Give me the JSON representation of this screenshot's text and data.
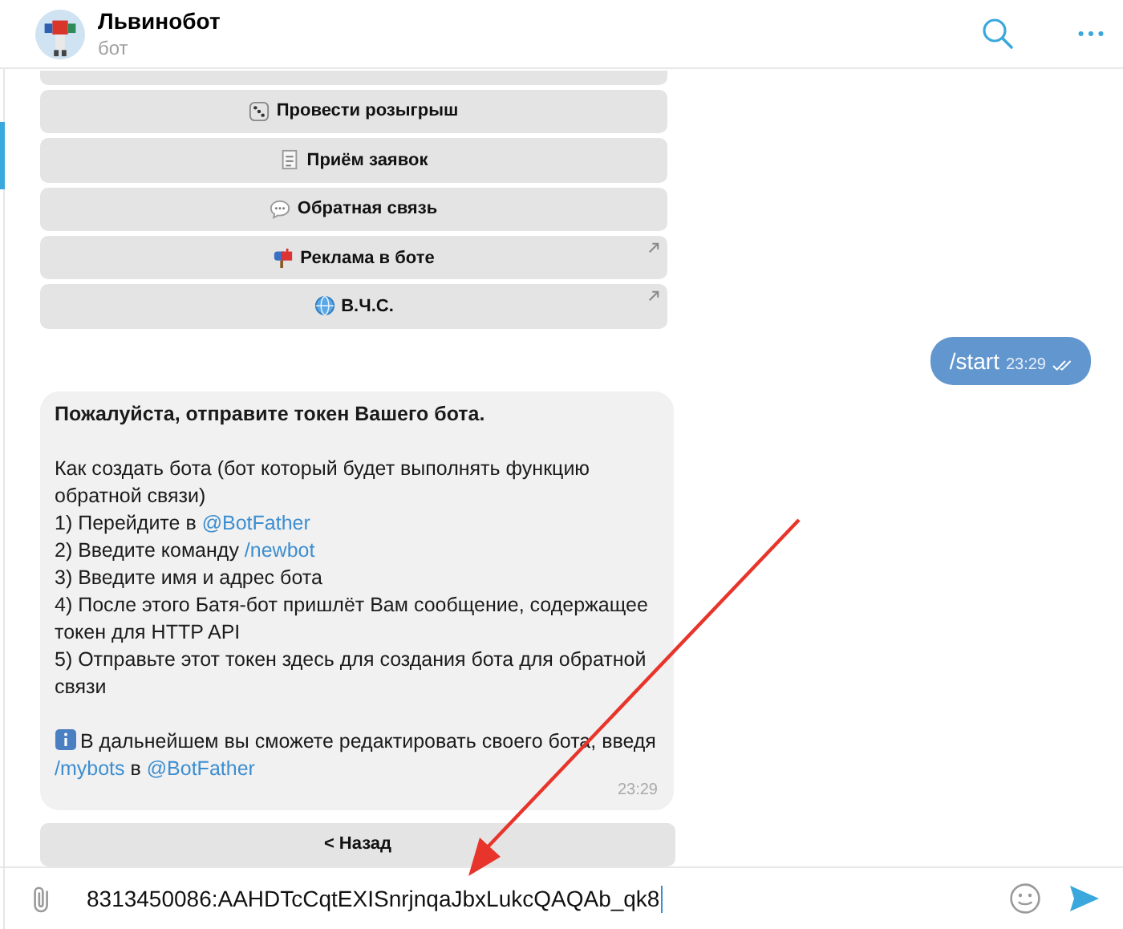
{
  "header": {
    "title": "Львинобот",
    "subtitle": "бот"
  },
  "keyboard_buttons": [
    {
      "label": "Провести розыгрыш",
      "opens_link": false
    },
    {
      "label": "Приём заявок",
      "opens_link": false
    },
    {
      "label": "Обратная связь",
      "opens_link": false
    },
    {
      "label": "Реклама в боте",
      "opens_link": true
    },
    {
      "label": "В.Ч.С.",
      "opens_link": true
    }
  ],
  "outgoing": {
    "text": "/start",
    "time": "23:29",
    "read": true
  },
  "incoming": {
    "title": "Пожалуйста, отправите токен Вашего бота.",
    "time": "23:29",
    "blocks": [
      [
        [
          {
            "text": "Как создать бота (бот который будет выполнять функцию обратной связи)",
            "link": false
          }
        ],
        [
          {
            "text": "1) Перейдите в ",
            "link": false
          },
          {
            "text": "@BotFather",
            "link": true
          }
        ],
        [
          {
            "text": "2) Введите команду ",
            "link": false
          },
          {
            "text": "/newbot",
            "link": true
          }
        ],
        [
          {
            "text": "3) Введите имя и адрес бота",
            "link": false
          }
        ],
        [
          {
            "text": "4) После этого Батя-бот пришлёт Вам сообщение, содержащее токен для HTTP API",
            "link": false
          }
        ],
        [
          {
            "text": "5) Отправьте этот токен здесь для создания бота для обратной связи",
            "link": false
          }
        ]
      ],
      [
        [
          {
            "text": "В дальнейшем вы сможете редактировать своего бота, введя ",
            "link": false
          },
          {
            "text": "/mybots",
            "link": true
          },
          {
            "text": " в ",
            "link": false
          },
          {
            "text": "@BotFather",
            "link": true
          }
        ]
      ]
    ]
  },
  "reply_buttons": [
    {
      "label": "< Назад"
    }
  ],
  "composer": {
    "value": "8313450086:AAHDTcCqtEXISnrjnqaJbxLukcQAQAb_qk8"
  }
}
